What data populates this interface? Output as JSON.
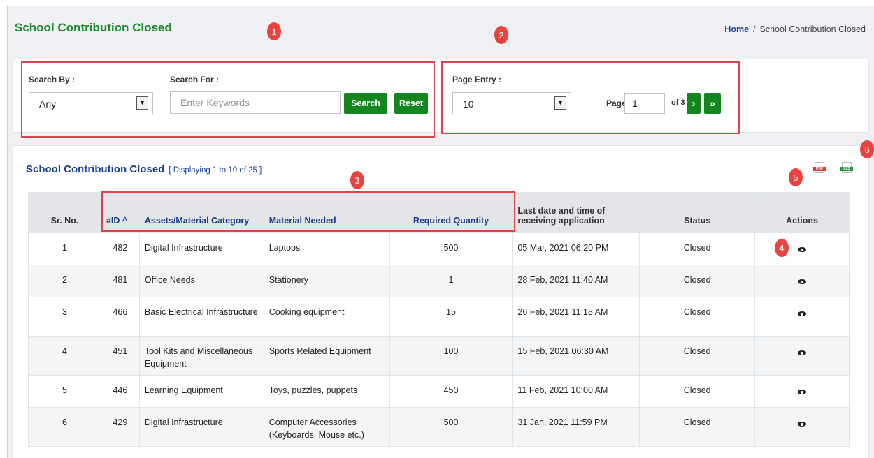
{
  "header": {
    "title": "School Contribution Closed"
  },
  "breadcrumb": {
    "home": "Home",
    "separator": "/",
    "current": "School Contribution Closed"
  },
  "search": {
    "by_label": "Search By :",
    "by_value": "Any",
    "for_label": "Search For :",
    "placeholder": "Enter Keywords",
    "search_button": "Search",
    "reset_button": "Reset"
  },
  "paging": {
    "entry_label": "Page Entry :",
    "entry_value": "10",
    "page_label": "Page :",
    "page_value": "1",
    "of_text": "of 3",
    "next_icon": "›",
    "last_icon": "»"
  },
  "markers": [
    "1",
    "2",
    "3",
    "4",
    "5",
    "6"
  ],
  "card": {
    "title": "School Contribution Closed",
    "subtitle": "[ Displaying 1 to 10 of 25 ]",
    "pdf_label": "PDF",
    "xls_label": "XLS"
  },
  "table": {
    "headers": {
      "sr": "Sr. No.",
      "id": "#ID ^",
      "category": "Assets/Material Category",
      "material": "Material Needed",
      "qty": "Required Quantity",
      "last_date": "Last date and time of receiving application",
      "status": "Status",
      "actions": "Actions"
    },
    "rows": [
      {
        "sr": "1",
        "id": "482",
        "category": "Digital Infrastructure",
        "material": "Laptops",
        "qty": "500",
        "date": "05 Mar, 2021 06:20 PM",
        "status": "Closed"
      },
      {
        "sr": "2",
        "id": "481",
        "category": "Office Needs",
        "material": "Stationery",
        "qty": "1",
        "date": "28 Feb, 2021 11:40 AM",
        "status": "Closed"
      },
      {
        "sr": "3",
        "id": "466",
        "category": "Basic Electrical Infrastructure",
        "material": "Cooking equipment",
        "qty": "15",
        "date": "26 Feb, 2021 11:18 AM",
        "status": "Closed"
      },
      {
        "sr": "4",
        "id": "451",
        "category": "Tool Kits and Miscellaneous Equipment",
        "material": "Sports Related Equipment",
        "qty": "100",
        "date": "15 Feb, 2021 06:30 AM",
        "status": "Closed"
      },
      {
        "sr": "5",
        "id": "446",
        "category": "Learning Equipment",
        "material": "Toys, puzzles, puppets",
        "qty": "450",
        "date": "11 Feb, 2021 10:00 AM",
        "status": "Closed"
      },
      {
        "sr": "6",
        "id": "429",
        "category": "Digital Infrastructure",
        "material": "Computer Accessories (Keyboards, Mouse etc.)",
        "qty": "500",
        "date": "31 Jan, 2021 11:59 PM",
        "status": "Closed"
      }
    ]
  },
  "colors": {
    "green": "#14861f",
    "title_green": "#1f8a2e",
    "link_blue": "#1a3f8f",
    "highlight_red": "#d9454a"
  }
}
